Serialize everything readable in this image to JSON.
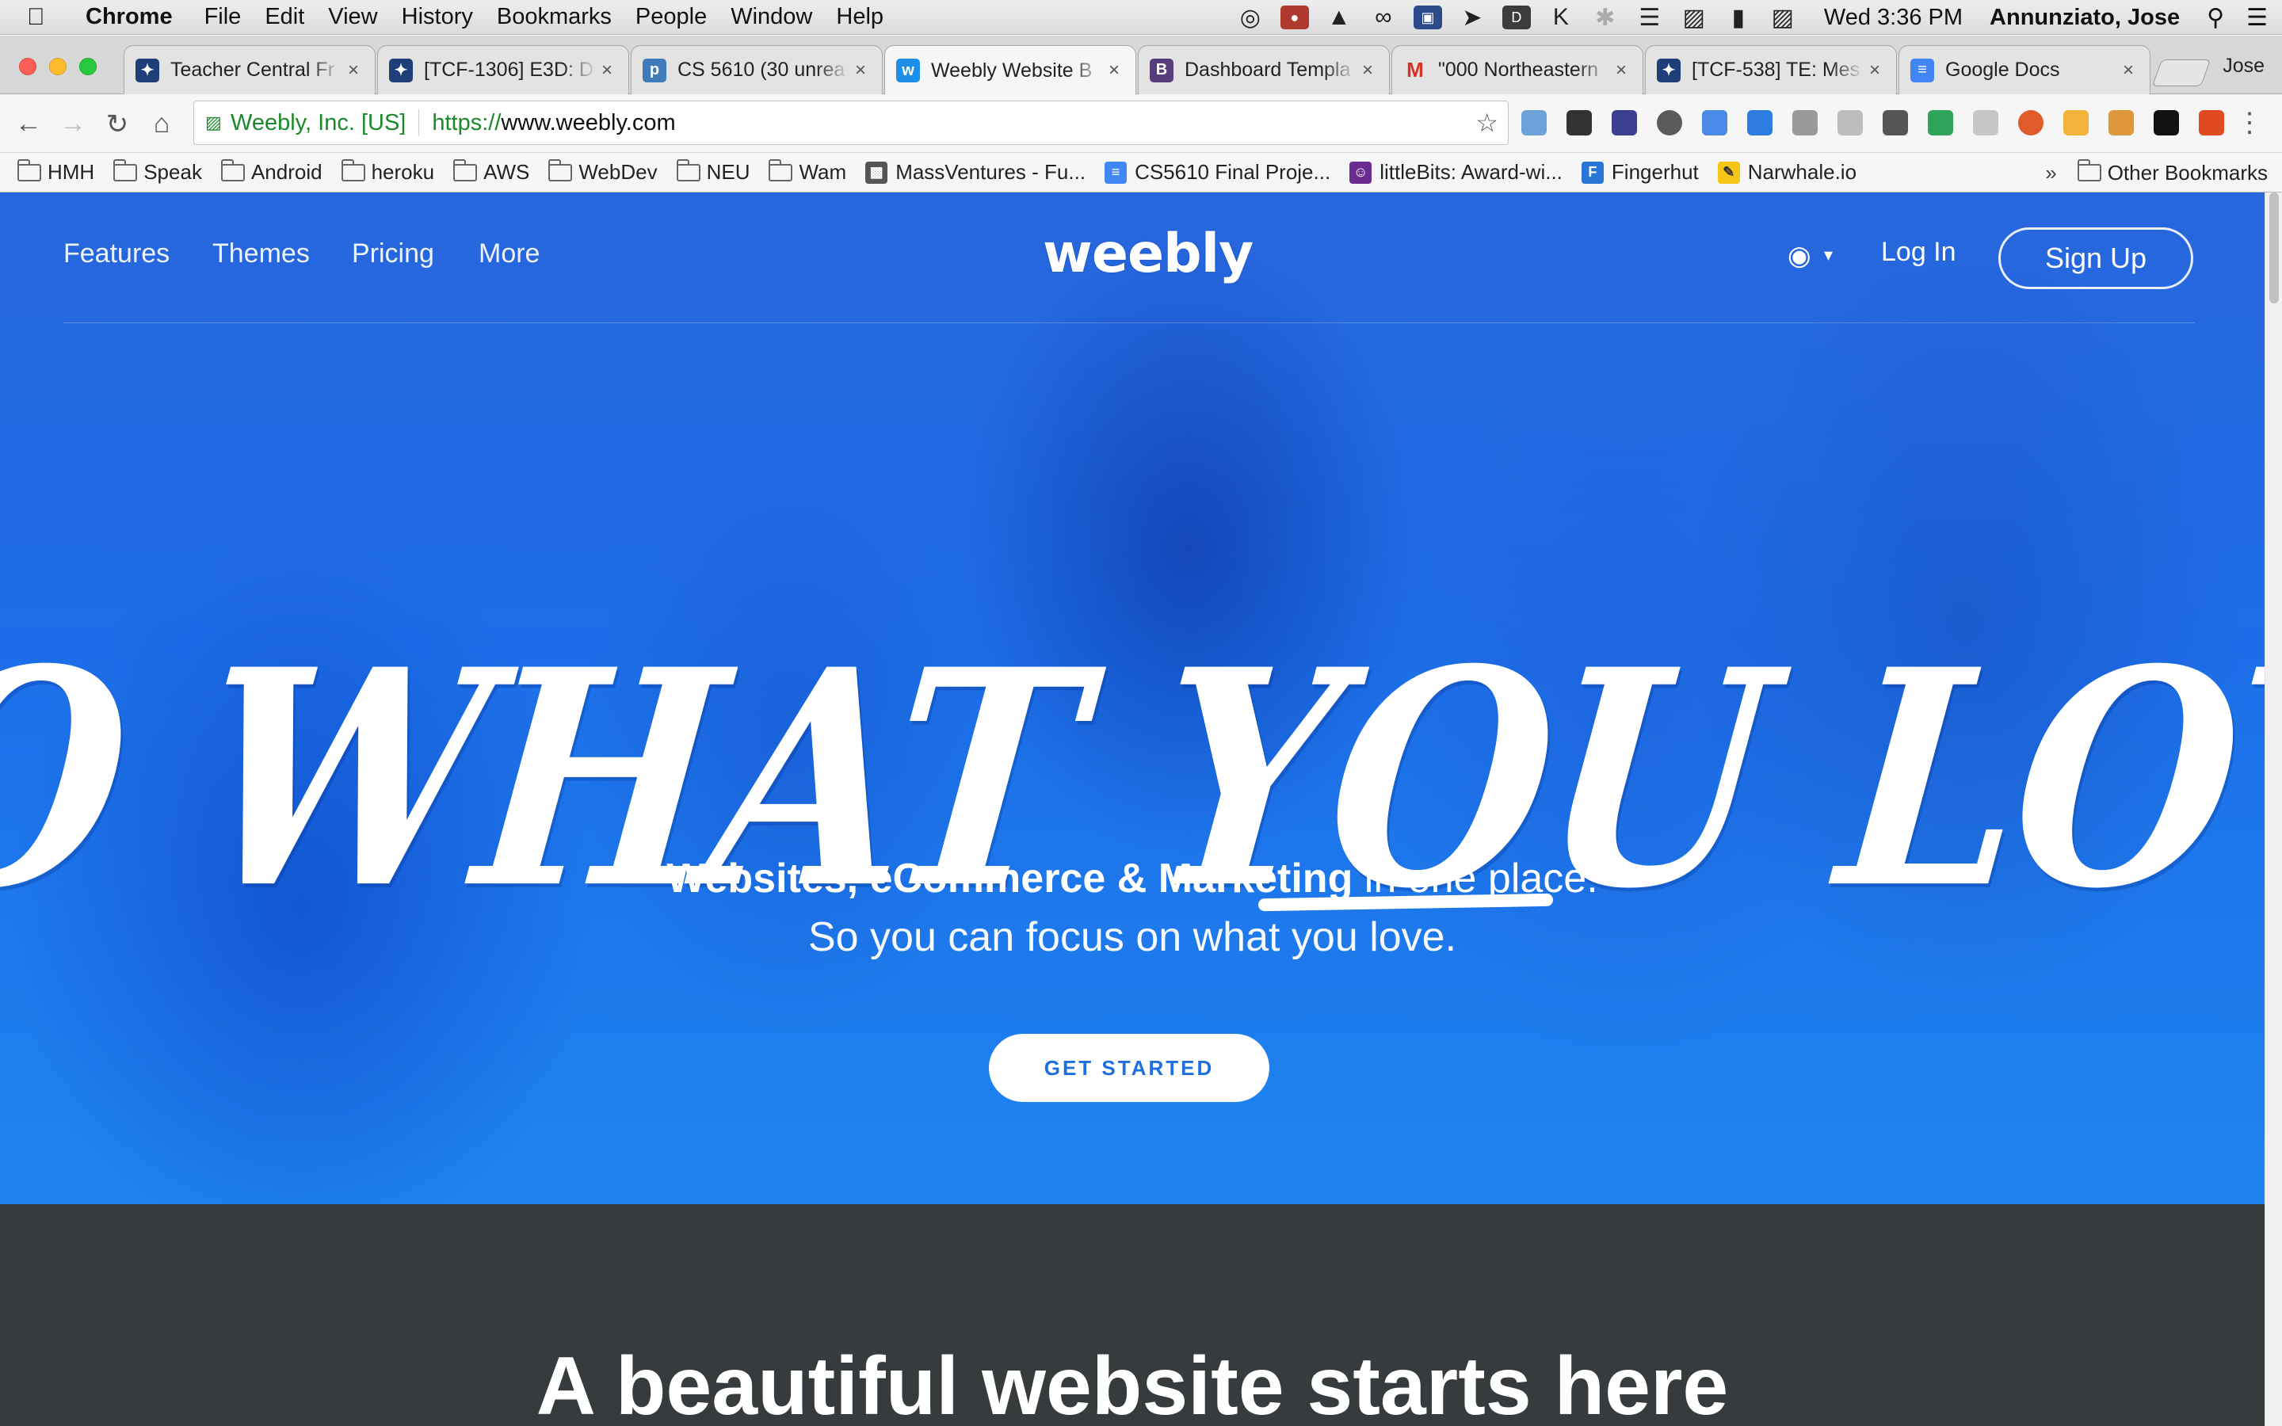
{
  "menubar": {
    "apple_icon": "apple-icon",
    "app_name": "Chrome",
    "items": [
      "File",
      "Edit",
      "View",
      "History",
      "Bookmarks",
      "People",
      "Window",
      "Help"
    ],
    "clock": "Wed 3:36 PM",
    "user": "Annunziato, Jose"
  },
  "tabs": [
    {
      "title": "Teacher Central Fr",
      "icon": "atlassian-icon",
      "color": "#1f3f7a"
    },
    {
      "title": "[TCF-1306] E3D: D",
      "icon": "atlassian-icon",
      "color": "#1f3f7a"
    },
    {
      "title": "CS 5610 (30 unrea",
      "icon": "piazza-icon",
      "color": "#3e7bb8"
    },
    {
      "title": "Weebly Website B",
      "icon": "weebly-icon",
      "color": "#1e8fe8",
      "active": true
    },
    {
      "title": "Dashboard Templa",
      "icon": "bootstrap-icon",
      "color": "#563d7c"
    },
    {
      "title": "\"000 Northeastern",
      "icon": "gmail-icon",
      "color": "#d93025"
    },
    {
      "title": "[TCF-538] TE: Mes",
      "icon": "atlassian-icon",
      "color": "#1f3f7a"
    },
    {
      "title": "Google Docs",
      "icon": "docs-icon",
      "color": "#4285f4"
    }
  ],
  "profile_name": "Jose",
  "omnibox": {
    "origin": "Weebly, Inc. [US]",
    "scheme": "https://",
    "host": "www.weebly.com"
  },
  "bookmarks": [
    {
      "label": "HMH",
      "type": "folder"
    },
    {
      "label": "Speak",
      "type": "folder"
    },
    {
      "label": "Android",
      "type": "folder"
    },
    {
      "label": "heroku",
      "type": "folder"
    },
    {
      "label": "AWS",
      "type": "folder"
    },
    {
      "label": "WebDev",
      "type": "folder"
    },
    {
      "label": "NEU",
      "type": "folder"
    },
    {
      "label": "Wam",
      "type": "folder"
    },
    {
      "label": "MassVentures - Fu...",
      "type": "link",
      "icon": "bar-chart-icon",
      "color": "#555555"
    },
    {
      "label": "CS5610 Final Proje...",
      "type": "link",
      "icon": "docs-icon",
      "color": "#4285f4"
    },
    {
      "label": "littleBits: Award-wi...",
      "type": "link",
      "icon": "littlebits-icon",
      "color": "#6b2c91"
    },
    {
      "label": "Fingerhut",
      "type": "link",
      "icon": "fingerhut-icon",
      "color": "#2877d6"
    },
    {
      "label": "Narwhale.io",
      "type": "link",
      "icon": "narwhale-icon",
      "color": "#f5c518"
    }
  ],
  "other_bookmarks": "Other Bookmarks",
  "site": {
    "nav": [
      "Features",
      "Themes",
      "Pricing",
      "More"
    ],
    "logo": "weebly",
    "login": "Log In",
    "signup": "Sign Up",
    "headline": "DO WHAT YOU LOVE",
    "sub_bold": "Websites, eCommerce & Marketing",
    "sub_rest": " in one place.",
    "sub2": "So you can focus on what you love.",
    "cta": "GET STARTED",
    "section_title": "A beautiful website starts here"
  },
  "colors": {
    "hero_blue": "#1f7ae8",
    "cta_text": "#1e6fe0",
    "dark_section": "#363b3e",
    "secure_green": "#1a8a2a"
  }
}
